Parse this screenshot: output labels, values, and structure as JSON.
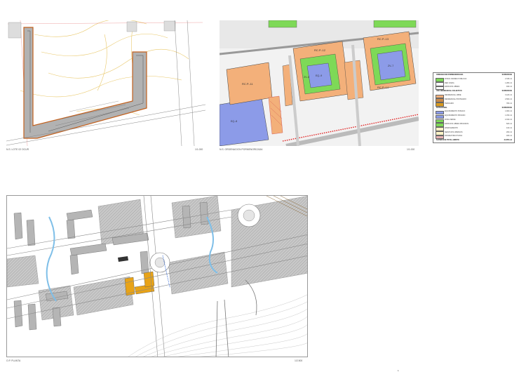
{
  "sheets": [
    {
      "id": "plan-1",
      "caption_left": "N.S. LOTE 02 OCUR",
      "caption_right": "1/1.000"
    },
    {
      "id": "plan-2",
      "caption_left": "N.S. ORDENACION PORMENORIZADA",
      "caption_right": "1/1.000"
    },
    {
      "id": "plan-3",
      "caption_left": "O.P. PLANTA",
      "caption_right": "1/2.500"
    }
  ],
  "labels": {
    "plot_a": "RC.P.-11",
    "plot_b": "RC.P.-12",
    "plot_c": "RC.P.-13",
    "plot_d": "RC.P.-14",
    "green_1": "ZV.-6",
    "green_2": "ZV.-7",
    "equip_1": "EQ.-8",
    "equip_2": "EQ.-9"
  },
  "legend": {
    "rows": [
      {
        "label": "ORDENACION PORMENORIZADA",
        "right": "SUPERFICIE",
        "color": "#ffffff",
        "header": true
      },
      {
        "label": "ZONAS VERDES PUBLICAS",
        "right": "2.345 m2",
        "color": "#7ed957",
        "header": false
      },
      {
        "label": "RED VIARIA",
        "right": "1.280 m2",
        "color": "#ffffff",
        "header": false
      },
      {
        "label": "ESPACIOS LIBRES",
        "right": "940 m2",
        "color": "#ffffff",
        "header": false
      },
      {
        "label": "USO RESIDENCIAL COLECTIVO",
        "right": "SUPERFICIE",
        "color": "#ffffff",
        "header": true
      },
      {
        "label": "RESIDENCIAL LIBRE",
        "right": "3.120 m2",
        "color": "#f3b07a",
        "header": false
      },
      {
        "label": "RESIDENCIAL PROTEGIDO",
        "right": "2.660 m2",
        "color": "#c88a4a",
        "header": false
      },
      {
        "label": "TERCIARIO",
        "right": "780 m2",
        "color": "#d99a1e",
        "header": false
      },
      {
        "label": "DOTACIONAL",
        "right": "SUPERFICIE",
        "color": "#ffffff",
        "header": true
      },
      {
        "label": "EQUIPAMIENTO PUBLICO",
        "right": "1.900 m2",
        "color": "#8c9be8",
        "header": false
      },
      {
        "label": "EQUIPAMIENTO PRIVADO",
        "right": "1.150 m2",
        "color": "#8c9be8",
        "header": false
      },
      {
        "label": "ZONA VERDE",
        "right": "2.010 m2",
        "color": "#7ed957",
        "header": false
      },
      {
        "label": "ESPACIOS LIBRES PRIVADOS",
        "right": "620 m2",
        "color": "#7ed957",
        "header": false
      },
      {
        "label": "APARCAMIENTO",
        "right": "410 m2",
        "color": "#fdf3c6",
        "header": false
      },
      {
        "label": "SERVICIOS URBANOS",
        "right": "260 m2",
        "color": "#fdf3c6",
        "header": false
      },
      {
        "label": "INFRAESTRUCTURAS",
        "right": "180 m2",
        "color": "#e8b4b4",
        "header": false
      },
      {
        "label": "SUPERFICIE TOTAL AMBITO",
        "right": "21.655 m2",
        "color": "#ffffff",
        "header": true
      }
    ]
  },
  "page_number": "1",
  "colors": {
    "residential": "#f3b07a",
    "green": "#7ed957",
    "equipment": "#8c9be8",
    "road": "#f2f2f2",
    "built": "#a9a9a9",
    "highlight": "#e8a317",
    "river": "#7fbfe8",
    "boundary": "#e02020"
  }
}
